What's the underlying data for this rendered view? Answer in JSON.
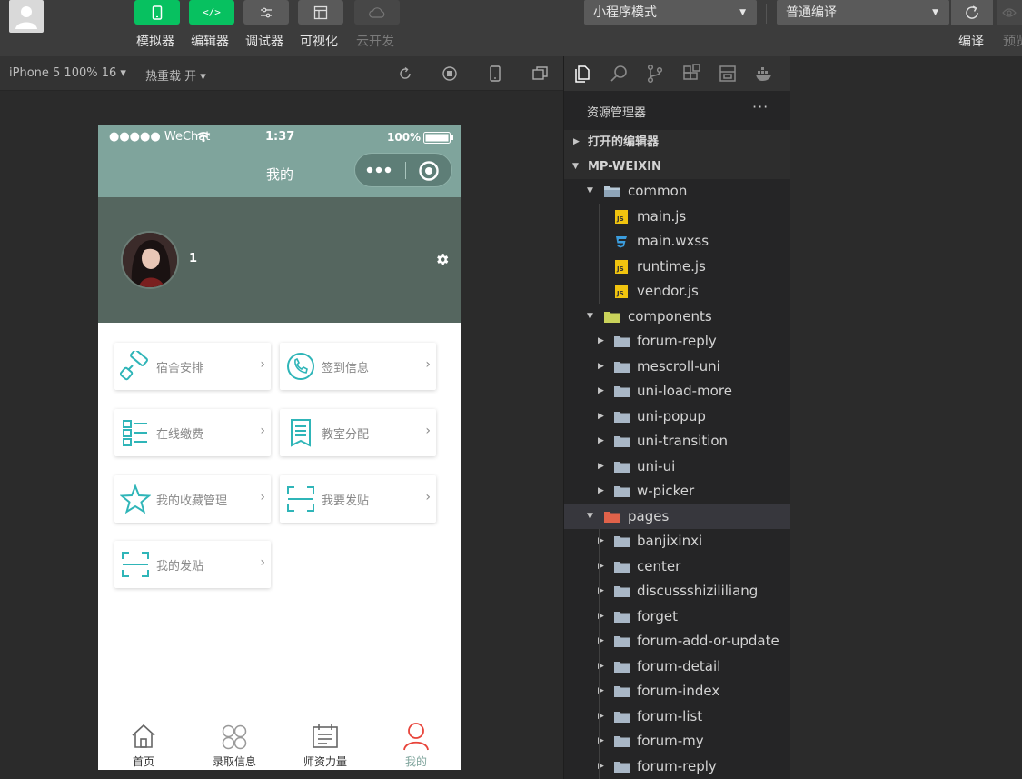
{
  "toolbar": {
    "buttons": [
      {
        "label": "模拟器"
      },
      {
        "label": "编辑器"
      },
      {
        "label": "调试器"
      },
      {
        "label": "可视化"
      },
      {
        "label": "云开发"
      }
    ],
    "mode_select": "小程序模式",
    "compile_select": "普通编译",
    "compile_label": "编译",
    "preview_label": "预览"
  },
  "simbar": {
    "device": "iPhone 5 100% 16 ▾",
    "hot_reload": "热重载 开 ▾"
  },
  "phone": {
    "status": {
      "carrier": "●●●●● WeChat",
      "time": "1:37",
      "battery": "100%"
    },
    "nav_title": "我的",
    "username": "1",
    "menu": [
      {
        "label": "宿舍安排",
        "icon": "roller-icon"
      },
      {
        "label": "签到信息",
        "icon": "phone-icon"
      },
      {
        "label": "在线缴费",
        "icon": "list-icon"
      },
      {
        "label": "教室分配",
        "icon": "bookmark-icon"
      },
      {
        "label": "我的收藏管理",
        "icon": "star-icon"
      },
      {
        "label": "我要发贴",
        "icon": "scan-icon"
      },
      {
        "label": "我的发贴",
        "icon": "scan-icon"
      }
    ],
    "tabs": [
      {
        "label": "首页",
        "icon": "home-icon"
      },
      {
        "label": "录取信息",
        "icon": "grid-icon"
      },
      {
        "label": "师资力量",
        "icon": "calendar-icon"
      },
      {
        "label": "我的",
        "icon": "user-icon"
      }
    ],
    "colors": {
      "theme": "#7fa49c",
      "header": "#55665f",
      "accent": "#2fb5b8"
    }
  },
  "explorer": {
    "title": "资源管理器",
    "open_editors": "打开的编辑器",
    "project": "MP-WEIXIN",
    "tree": [
      {
        "label": "common",
        "type": "folder-open",
        "depth": 1
      },
      {
        "label": "main.js",
        "type": "js",
        "depth": 2
      },
      {
        "label": "main.wxss",
        "type": "css",
        "depth": 2
      },
      {
        "label": "runtime.js",
        "type": "js",
        "depth": 2
      },
      {
        "label": "vendor.js",
        "type": "js",
        "depth": 2
      },
      {
        "label": "components",
        "type": "folder-components",
        "depth": 1
      },
      {
        "label": "forum-reply",
        "type": "folder",
        "depth": 2
      },
      {
        "label": "mescroll-uni",
        "type": "folder",
        "depth": 2
      },
      {
        "label": "uni-load-more",
        "type": "folder",
        "depth": 2
      },
      {
        "label": "uni-popup",
        "type": "folder",
        "depth": 2
      },
      {
        "label": "uni-transition",
        "type": "folder",
        "depth": 2
      },
      {
        "label": "uni-ui",
        "type": "folder",
        "depth": 2
      },
      {
        "label": "w-picker",
        "type": "folder",
        "depth": 2
      },
      {
        "label": "pages",
        "type": "folder-pages",
        "depth": 1
      },
      {
        "label": "banjixinxi",
        "type": "folder",
        "depth": 2
      },
      {
        "label": "center",
        "type": "folder",
        "depth": 2
      },
      {
        "label": "discussshizililiang",
        "type": "folder",
        "depth": 2
      },
      {
        "label": "forget",
        "type": "folder",
        "depth": 2
      },
      {
        "label": "forum-add-or-update",
        "type": "folder",
        "depth": 2
      },
      {
        "label": "forum-detail",
        "type": "folder",
        "depth": 2
      },
      {
        "label": "forum-index",
        "type": "folder",
        "depth": 2
      },
      {
        "label": "forum-list",
        "type": "folder",
        "depth": 2
      },
      {
        "label": "forum-my",
        "type": "folder",
        "depth": 2
      },
      {
        "label": "forum-reply",
        "type": "folder",
        "depth": 2
      }
    ]
  }
}
